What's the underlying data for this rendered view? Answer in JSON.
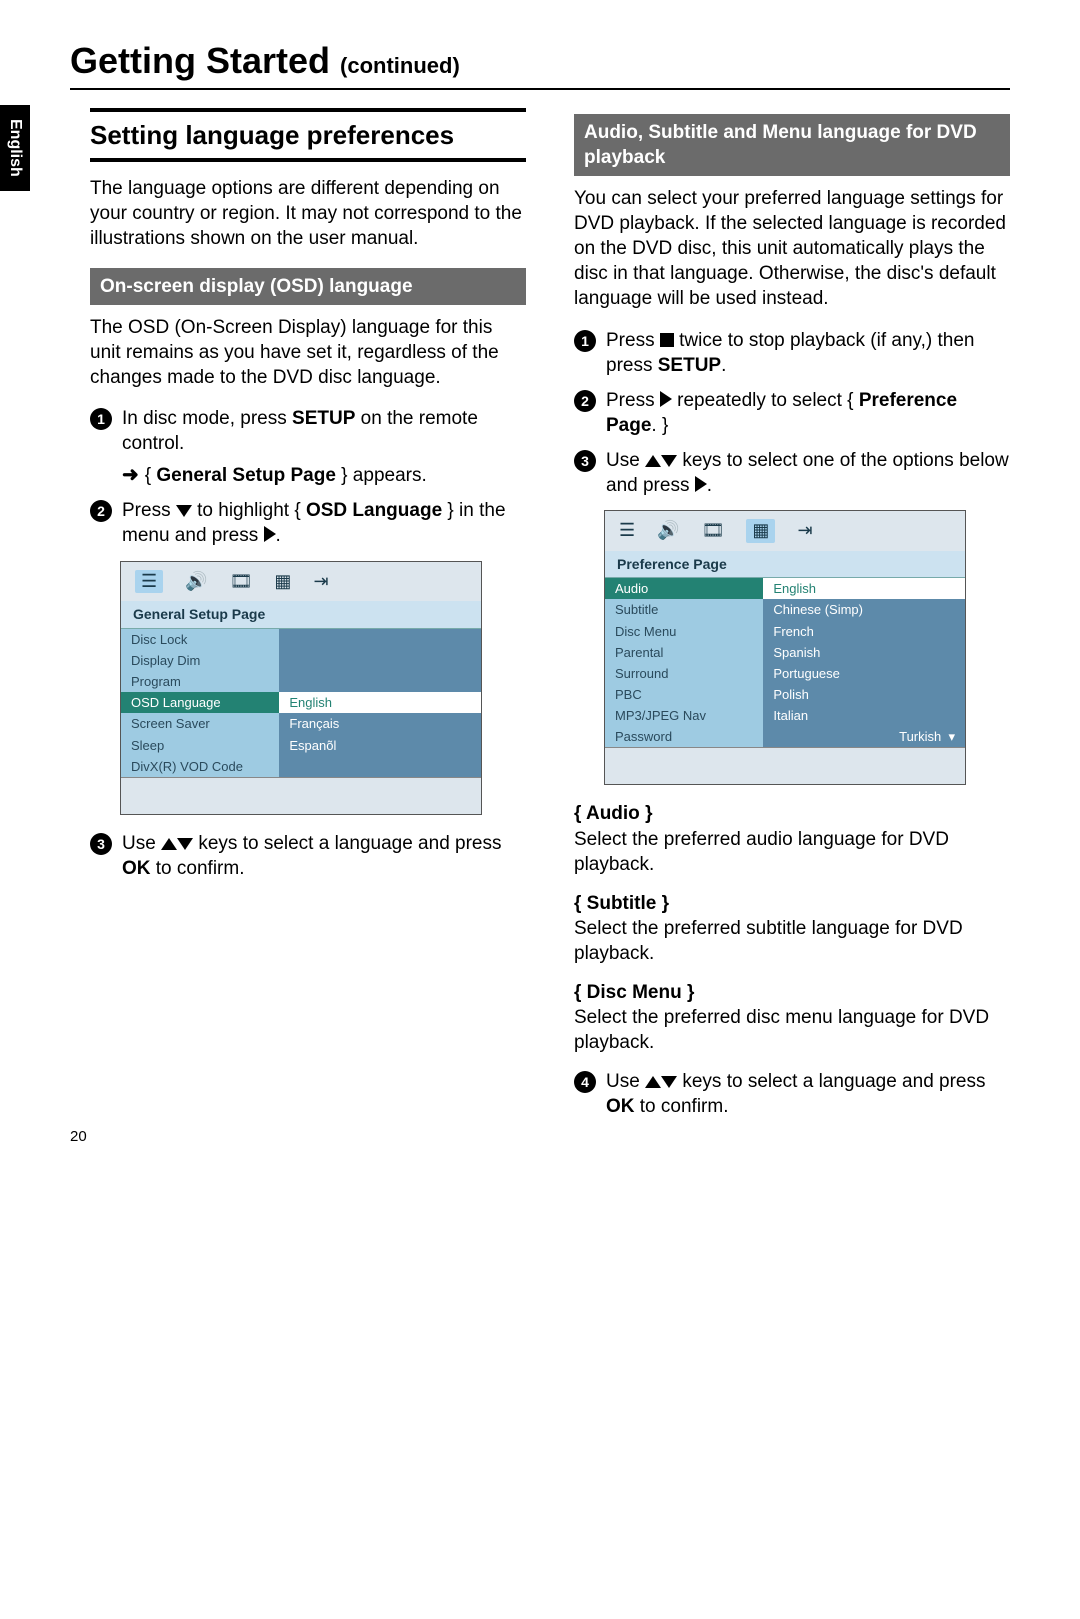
{
  "page_number": "20",
  "language_tab": "English",
  "title_main": "Getting Started",
  "title_cont": "(continued)",
  "left": {
    "section_heading": "Setting language preferences",
    "intro": "The language options are different depending on your country or region.  It may not correspond to the illustrations shown on the user manual.",
    "sub_bar": "On-screen display (OSD) language",
    "osd_para": "The OSD (On-Screen Display) language for this unit remains as you have set it, regardless of the changes made to the DVD disc language.",
    "step1_a": "In disc mode, press ",
    "step1_b": "SETUP",
    "step1_c": " on the remote control.",
    "step1_sub_prefix": "{ ",
    "step1_sub_bold": "General Setup Page",
    "step1_sub_suffix": " } appears.",
    "step2_a": "Press ",
    "step2_b": " to highlight { ",
    "step2_c": "OSD Language",
    "step2_d": " } in the menu and press ",
    "step2_e": ".",
    "osd_menu": {
      "title": "General Setup Page",
      "left_items": [
        "Disc Lock",
        "Display Dim",
        "Program",
        "OSD Language",
        "Screen Saver",
        "Sleep",
        "DivX(R) VOD Code"
      ],
      "selected_left": "OSD Language",
      "right_items": [
        "English",
        "Français",
        "Espanõl"
      ],
      "selected_right": "English"
    },
    "step3_a": "Use ",
    "step3_b": " keys to select a language and press ",
    "step3_c": "OK",
    "step3_d": " to confirm."
  },
  "right": {
    "sub_bar": "Audio, Subtitle and Menu language for DVD playback",
    "intro": "You can select your preferred language settings for DVD playback.  If the selected language is recorded on the DVD disc, this unit automatically plays the disc in that language.  Otherwise, the disc's default language will be used instead.",
    "step1_a": "Press ",
    "step1_b": " twice to stop playback (if any,) then press ",
    "step1_c": "SETUP",
    "step1_d": ".",
    "step2_a": "Press ",
    "step2_b": " repeatedly to select { ",
    "step2_c": "Preference Page",
    "step2_d": ". }",
    "step3_a": "Use ",
    "step3_b": " keys to select one of the options below and press ",
    "step3_c": ".",
    "osd_menu": {
      "title": "Preference Page",
      "left_items": [
        "Audio",
        "Subtitle",
        "Disc Menu",
        "Parental",
        "Surround",
        "PBC",
        "MP3/JPEG Nav",
        "Password"
      ],
      "selected_left": "Audio",
      "right_items": [
        "English",
        "Chinese (Simp)",
        "French",
        "Spanish",
        "Portuguese",
        "Polish",
        "Italian",
        "Turkish"
      ],
      "selected_right": "English"
    },
    "opt_audio_title": "{ Audio }",
    "opt_audio_body": "Select the preferred audio language for DVD playback.",
    "opt_sub_title": "{ Subtitle }",
    "opt_sub_body": "Select the preferred subtitle language for DVD playback.",
    "opt_menu_title": "{ Disc Menu }",
    "opt_menu_body": "Select the preferred disc menu language for DVD playback.",
    "step4_a": "Use ",
    "step4_b": " keys to select a language and press ",
    "step4_c": "OK",
    "step4_d": " to confirm."
  }
}
